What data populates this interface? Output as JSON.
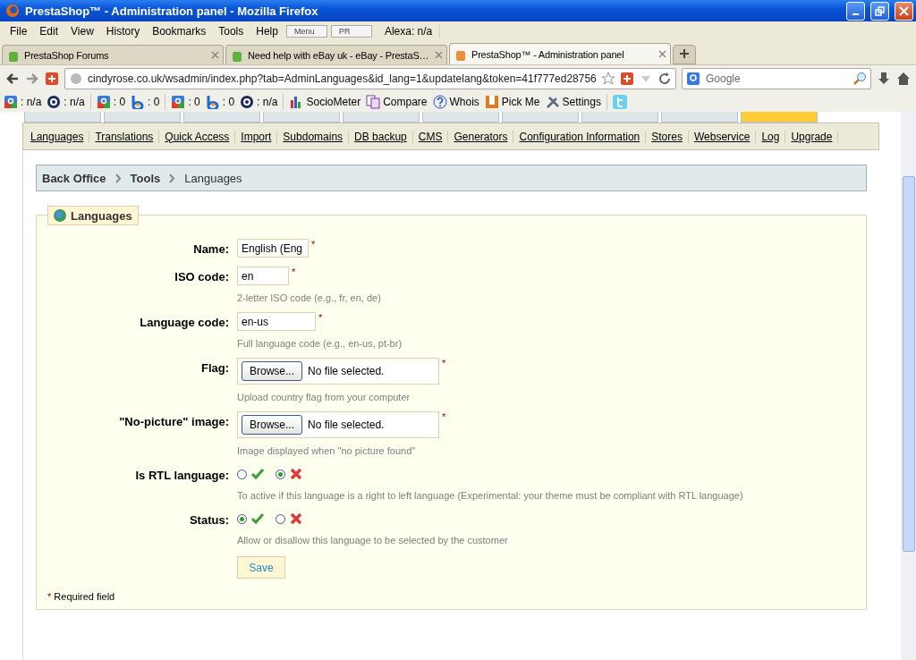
{
  "window": {
    "title": "PrestaShop™ - Administration panel - Mozilla Firefox"
  },
  "menu": [
    "File",
    "Edit",
    "View",
    "History",
    "Bookmarks",
    "Tools",
    "Help"
  ],
  "menu_widgets": [
    "Menu",
    "PR"
  ],
  "alexa": "Alexa: n/a",
  "tabs": [
    {
      "label": "PrestaShop Forums",
      "selected": false
    },
    {
      "label": "Need help with eBay uk - eBay - PrestaS…",
      "selected": false
    },
    {
      "label": "PrestaShop™ - Administration panel",
      "selected": true
    }
  ],
  "address": {
    "url": "cindyrose.co.uk/wsadmin/index.php?tab=AdminLanguages&id_lang=1&updatelang&token=41f777ed28756"
  },
  "search": {
    "placeholder": "Google"
  },
  "toolbar": [
    {
      "kind": "google",
      "text": ": n/a"
    },
    {
      "kind": "alexa",
      "text": ": n/a"
    },
    {
      "kind": "separator"
    },
    {
      "kind": "google",
      "text": ": 0"
    },
    {
      "kind": "bing",
      "text": ": 0"
    },
    {
      "kind": "separator"
    },
    {
      "kind": "google",
      "text": ": 0"
    },
    {
      "kind": "bing",
      "text": ": 0"
    },
    {
      "kind": "alexa",
      "text": ": n/a"
    },
    {
      "kind": "separator"
    },
    {
      "kind": "chart",
      "text": "SocioMeter"
    },
    {
      "kind": "compare",
      "text": "Compare"
    },
    {
      "kind": "whois",
      "text": "Whois"
    },
    {
      "kind": "pickme",
      "text": "Pick Me"
    },
    {
      "kind": "settings",
      "text": "Settings"
    },
    {
      "kind": "separator"
    },
    {
      "kind": "twitter"
    }
  ],
  "module_tabs": [
    {
      "selected": false
    },
    {
      "selected": false
    },
    {
      "selected": false
    },
    {
      "selected": false
    },
    {
      "selected": false
    },
    {
      "selected": false
    },
    {
      "selected": false
    },
    {
      "selected": false
    },
    {
      "selected": false
    },
    {
      "selected": true
    }
  ],
  "subnav": [
    "Languages",
    "Translations",
    "Quick Access",
    "Import",
    "Subdomains",
    "DB backup",
    "CMS",
    "Generators",
    "Configuration Information",
    "Stores",
    "Webservice",
    "Log",
    "Upgrade"
  ],
  "breadcrumb": [
    "Back Office",
    "Tools",
    "Languages"
  ],
  "form": {
    "legend": "Languages",
    "fields": [
      {
        "kind": "text",
        "label": "Name:",
        "value": "English (Eng",
        "required": true
      },
      {
        "kind": "text",
        "label": "ISO code:",
        "value": "en",
        "required": true,
        "hint": "2-letter ISO code (e.g., fr, en, de)"
      },
      {
        "kind": "text",
        "label": "Language code:",
        "value": "en-us",
        "required": true,
        "hint": "Full language code (e.g., en-us, pt-br)"
      },
      {
        "kind": "file",
        "label": "Flag:",
        "button": "Browse...",
        "value": "No file selected.",
        "required": true,
        "hint": "Upload country flag from your computer"
      },
      {
        "kind": "file",
        "label": "\"No-picture\" image:",
        "button": "Browse...",
        "value": "No file selected.",
        "required": true,
        "hint": "Image displayed when \"no picture found\""
      },
      {
        "kind": "radio",
        "label": "Is RTL language:",
        "options": [
          {
            "kind": "check",
            "selected": false
          },
          {
            "kind": "cross",
            "selected": true
          }
        ],
        "hint": "To active if this language is a right to left language (Experimental: your theme must be compliant with RTL language)"
      },
      {
        "kind": "radio",
        "label": "Status:",
        "options": [
          {
            "kind": "check",
            "selected": true
          },
          {
            "kind": "cross",
            "selected": false
          }
        ],
        "hint": "Allow or disallow this language to be selected by the customer"
      }
    ],
    "save": "Save",
    "required_mark": "*",
    "required_note": "Required field"
  }
}
